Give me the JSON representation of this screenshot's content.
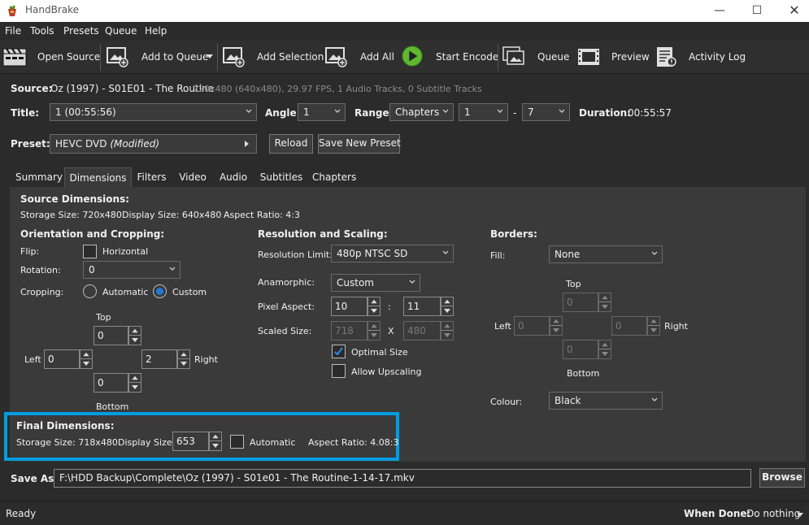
{
  "window": {
    "title": "HandBrake",
    "app_icon": "pineapple-cocktail-icon"
  },
  "menu": [
    "File",
    "Tools",
    "Presets",
    "Queue",
    "Help"
  ],
  "toolbar": {
    "open_source": "Open Source",
    "add_to_queue": "Add to Queue",
    "add_selection": "Add Selection",
    "add_all": "Add All",
    "start_encode": "Start Encode",
    "queue": "Queue",
    "preview": "Preview",
    "activity_log": "Activity Log"
  },
  "source": {
    "label": "Source:",
    "name": "Oz (1997) - S01E01 - The Routine",
    "info": "720x480 (640x480), 29.97 FPS, 1 Audio Tracks, 0 Subtitle Tracks"
  },
  "title_row": {
    "title_label": "Title:",
    "title_value": "1  (00:55:56)",
    "angle_label": "Angle:",
    "angle_value": "1",
    "range_label": "Range:",
    "range_mode": "Chapters",
    "range_start": "1",
    "range_dash": "-",
    "range_end": "7",
    "duration_label": "Duration:",
    "duration_value": "00:55:57"
  },
  "preset": {
    "label": "Preset:",
    "name": "HEVC DVD",
    "modified": "(Modified)",
    "reload": "Reload",
    "save_new": "Save New Preset"
  },
  "tabs": [
    "Summary",
    "Dimensions",
    "Filters",
    "Video",
    "Audio",
    "Subtitles",
    "Chapters"
  ],
  "active_tab": "Dimensions",
  "source_dimensions": {
    "heading": "Source Dimensions:",
    "storage": "Storage Size: 720x480",
    "display": "Display Size: 640x480",
    "aspect": "Aspect Ratio: 4:3"
  },
  "orientation": {
    "heading": "Orientation and Cropping:",
    "flip_label": "Flip:",
    "horizontal_label": "Horizontal",
    "rotation_label": "Rotation:",
    "rotation_value": "0",
    "cropping_label": "Cropping:",
    "automatic_label": "Automatic",
    "custom_label": "Custom",
    "top_label": "Top",
    "bottom_label": "Bottom",
    "left_label": "Left",
    "right_label": "Right",
    "top_value": "0",
    "bottom_value": "0",
    "left_value": "0",
    "right_value": "2"
  },
  "resolution": {
    "heading": "Resolution and Scaling:",
    "limit_label": "Resolution Limit:",
    "limit_value": "480p NTSC SD",
    "anamorphic_label": "Anamorphic:",
    "anamorphic_value": "Custom",
    "pixel_aspect_label": "Pixel Aspect:",
    "pixel_aspect_w": "10",
    "pixel_aspect_sep": ":",
    "pixel_aspect_h": "11",
    "scaled_label": "Scaled Size:",
    "scaled_w": "718",
    "scaled_sep": "X",
    "scaled_h": "480",
    "optimal_label": "Optimal Size",
    "upscaling_label": "Allow Upscaling"
  },
  "borders": {
    "heading": "Borders:",
    "fill_label": "Fill:",
    "fill_value": "None",
    "top_label": "Top",
    "bottom_label": "Bottom",
    "left_label": "Left",
    "right_label": "Right",
    "top_value": "0",
    "bottom_value": "0",
    "left_value": "0",
    "right_value": "0",
    "colour_label": "Colour:",
    "colour_value": "Black"
  },
  "final_dimensions": {
    "heading": "Final Dimensions:",
    "storage": "Storage Size: 718x480",
    "display_label": "Display Size:",
    "display_value": "653",
    "automatic_label": "Automatic",
    "aspect": "Aspect Ratio: 4.08:3"
  },
  "save_as": {
    "label": "Save As:",
    "path": "F:\\HDD Backup\\Complete\\Oz (1997) - S01e01 - The Routine-1-14-17.mkv",
    "browse": "Browse"
  },
  "status": {
    "text": "Ready",
    "when_done_label": "When Done:",
    "when_done_value": "Do nothing"
  },
  "colors": {
    "highlight": "#009ee3",
    "radio_accent": "#1f7ad6",
    "play_green": "#5fb82f"
  }
}
